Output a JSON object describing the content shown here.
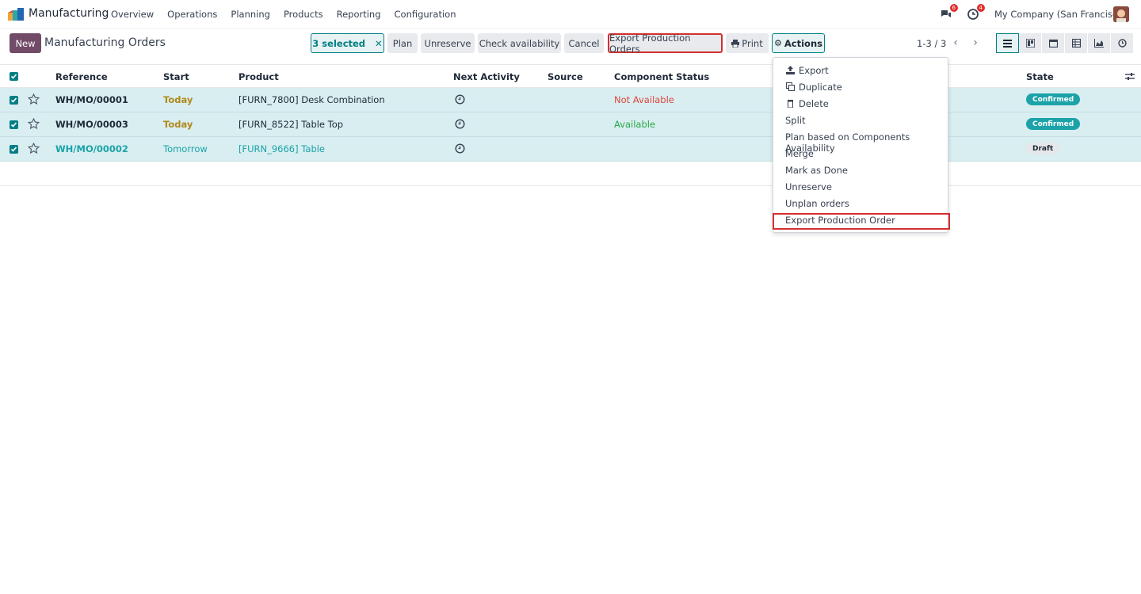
{
  "navbar": {
    "app_name": "Manufacturing",
    "menu": [
      "Overview",
      "Operations",
      "Planning",
      "Products",
      "Reporting",
      "Configuration"
    ],
    "messages_count": "6",
    "activities_count": "4",
    "company": "My Company (San Francisco)"
  },
  "control": {
    "new_label": "New",
    "title": "Manufacturing Orders",
    "selected_label": "3 selected",
    "plan_label": "Plan",
    "unreserve_label": "Unreserve",
    "check_label": "Check availability",
    "cancel_label": "Cancel",
    "export_label": "Export Production Orders",
    "print_label": "Print",
    "actions_label": "Actions",
    "pager": "1-3 / 3"
  },
  "table": {
    "headers": {
      "reference": "Reference",
      "start": "Start",
      "product": "Product",
      "next_activity": "Next Activity",
      "source": "Source",
      "component_status": "Component Status",
      "state": "State"
    },
    "rows": [
      {
        "reference": "WH/MO/00001",
        "start": "Today",
        "product": "[FURN_7800] Desk Combination",
        "component_status": "Not Available",
        "state": "Confirmed"
      },
      {
        "reference": "WH/MO/00003",
        "start": "Today",
        "product": "[FURN_8522] Table Top",
        "component_status": "Available",
        "state": "Confirmed"
      },
      {
        "reference": "WH/MO/00002",
        "start": "Tomorrow",
        "product": "[FURN_9666] Table",
        "component_status": "",
        "state": "Draft"
      }
    ]
  },
  "actions_menu": {
    "items": [
      "Export",
      "Duplicate",
      "Delete",
      "Split",
      "Plan based on Components Availability",
      "Merge",
      "Mark as Done",
      "Unreserve",
      "Unplan orders",
      "Export Production Order"
    ]
  },
  "colors": {
    "brand": "#714b67",
    "accent": "#017e84",
    "today": "#b08a1a",
    "not_available": "#e0443a",
    "available": "#28a745",
    "highlight_border": "#d32f2f"
  }
}
